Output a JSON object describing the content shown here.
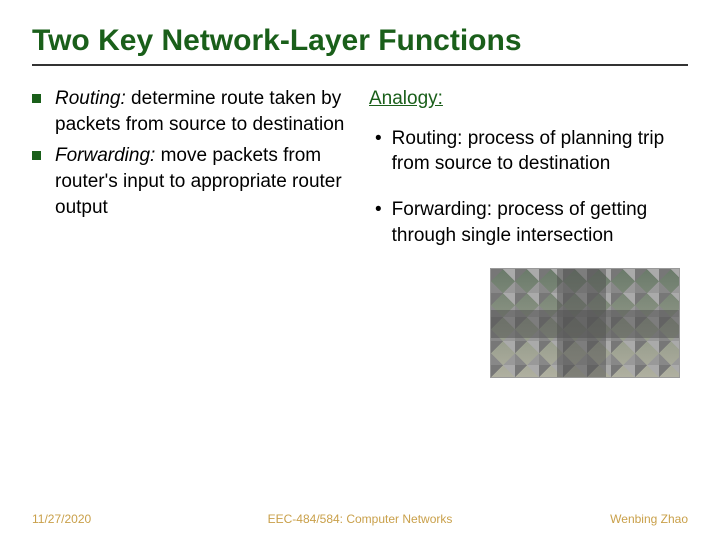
{
  "title": "Two Key Network-Layer Functions",
  "left": {
    "items": [
      {
        "term": "Routing:",
        "rest": " determine route taken by packets from source to destination"
      },
      {
        "term": "Forwarding:",
        "rest": " move packets from router's input to appropriate router output"
      }
    ]
  },
  "right": {
    "heading": "Analogy:",
    "items": [
      "Routing: process of planning trip from source to destination",
      "Forwarding: process of getting through single intersection"
    ],
    "image_alt": "aerial-intersection-photo"
  },
  "footer": {
    "date": "11/27/2020",
    "course": "EEC-484/584: Computer Networks",
    "author": "Wenbing Zhao"
  }
}
